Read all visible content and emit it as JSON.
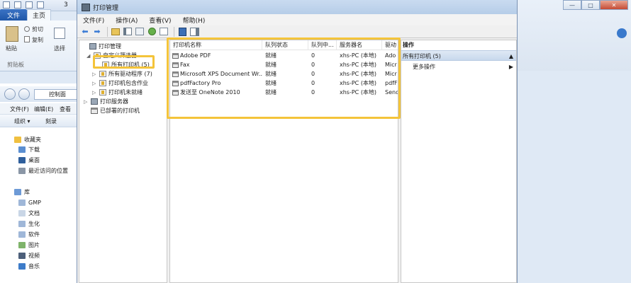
{
  "background": {
    "quick_access_text": "3",
    "tabs": {
      "file": "文件",
      "home": "主页"
    },
    "ribbon": {
      "paste": "粘贴",
      "cut": "剪切",
      "copy": "复制",
      "select": "选择",
      "clipboard_group": "剪贴板"
    },
    "explorer": {
      "address": "控制面",
      "menu": [
        "文件(F)",
        "编辑(E)",
        "查看"
      ],
      "commands": [
        "组织 ▾",
        "刻录"
      ],
      "nav_items": [
        {
          "label": "收藏夹",
          "icon": "star-icon",
          "header": true
        },
        {
          "label": "下载",
          "icon": "download-folder-icon"
        },
        {
          "label": "桌面",
          "icon": "desktop-icon"
        },
        {
          "label": "最近访问的位置",
          "icon": "recent-places-icon"
        },
        {
          "label": "库",
          "icon": "library-icon",
          "header": true
        },
        {
          "label": "GMP",
          "icon": "folder-icon"
        },
        {
          "label": "文档",
          "icon": "documents-icon"
        },
        {
          "label": "生化",
          "icon": "folder-icon"
        },
        {
          "label": "软件",
          "icon": "folder-icon"
        },
        {
          "label": "图片",
          "icon": "pictures-icon"
        },
        {
          "label": "视频",
          "icon": "videos-icon"
        },
        {
          "label": "音乐",
          "icon": "music-icon"
        }
      ]
    }
  },
  "window": {
    "title": "打印管理",
    "menu": [
      "文件(F)",
      "操作(A)",
      "查看(V)",
      "帮助(H)"
    ],
    "controls": {
      "minimize": "—",
      "maximize": "□",
      "close": "✕"
    }
  },
  "tree": [
    {
      "label": "打印管理",
      "indent": 0,
      "expander": "",
      "icon": "print-management-icon"
    },
    {
      "label": "自定义筛选器",
      "indent": 1,
      "expander": "◢",
      "icon": "filter-icon"
    },
    {
      "label": "所有打印机 (5)",
      "indent": 2,
      "expander": "",
      "icon": "filter-icon"
    },
    {
      "label": "所有驱动程序 (7)",
      "indent": 2,
      "expander": "▷",
      "icon": "filter-icon"
    },
    {
      "label": "打印机包含作业",
      "indent": 2,
      "expander": "▷",
      "icon": "filter-icon"
    },
    {
      "label": "打印机未就绪",
      "indent": 2,
      "expander": "▷",
      "icon": "filter-icon"
    },
    {
      "label": "打印服务器",
      "indent": 1,
      "expander": "▷",
      "icon": "server-icon"
    },
    {
      "label": "已部署的打印机",
      "indent": 1,
      "expander": "",
      "icon": "printer-icon"
    }
  ],
  "list": {
    "columns": [
      "打印机名称",
      "队列状态",
      "队列中...",
      "服务器名",
      "驱动"
    ],
    "rows": [
      [
        "Adobe PDF",
        "就绪",
        "0",
        "xhs-PC (本地)",
        "Ado"
      ],
      [
        "Fax",
        "就绪",
        "0",
        "xhs-PC (本地)",
        "Micr"
      ],
      [
        "Microsoft XPS Document Wr...",
        "就绪",
        "0",
        "xhs-PC (本地)",
        "Micr"
      ],
      [
        "pdfFactory Pro",
        "就绪",
        "0",
        "xhs-PC (本地)",
        "pdfF"
      ],
      [
        "发送至 OneNote 2010",
        "就绪",
        "0",
        "xhs-PC (本地)",
        "Send"
      ]
    ]
  },
  "actions": {
    "header": "操作",
    "section": "所有打印机 (5)",
    "section_arrow": "▲",
    "more": "更多操作",
    "more_arrow": "▶"
  },
  "colors": {
    "highlight_box": "#f4c43a",
    "title_bar": "#c9dbf0",
    "action_section": "#dfe9f5"
  }
}
